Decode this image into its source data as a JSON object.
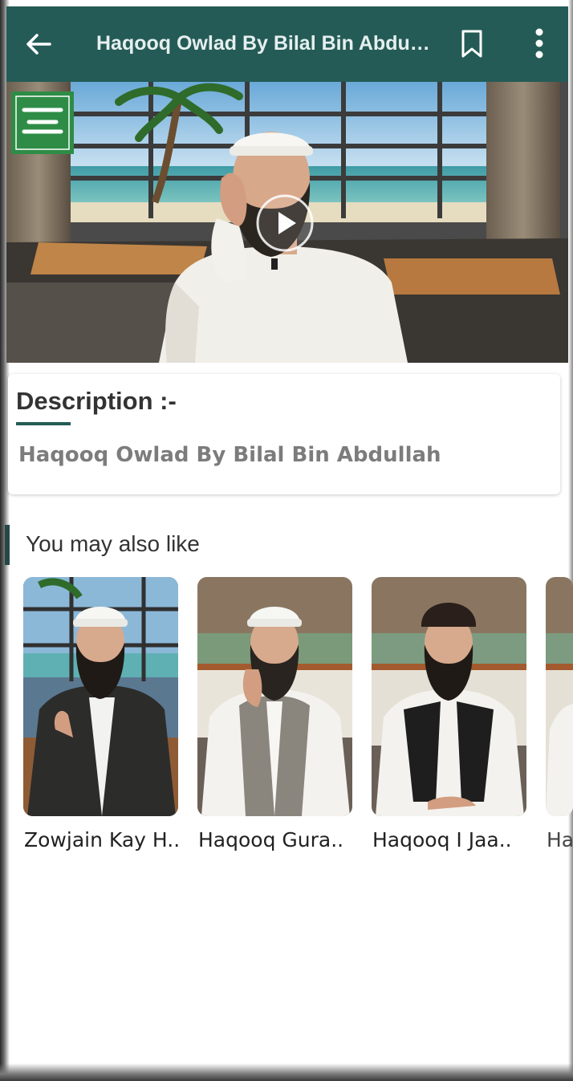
{
  "appbar": {
    "title": "Haqooq Owlad By Bilal Bin Abdull...",
    "icons": {
      "back": "arrow-left-icon",
      "bookmark": "bookmark-icon",
      "more": "more-vertical-icon"
    },
    "color": "#245b56"
  },
  "video": {
    "play_icon": "play-circle-icon"
  },
  "description": {
    "heading": "Description :-",
    "text": "Haqooq Owlad By Bilal Bin Abdullah"
  },
  "recommendations": {
    "title": "You may also like",
    "items": [
      {
        "title": "Zowjain Kay H.."
      },
      {
        "title": "Haqooq Gura.."
      },
      {
        "title": "Haqooq I Jaa.."
      },
      {
        "title": "Ha"
      }
    ]
  }
}
